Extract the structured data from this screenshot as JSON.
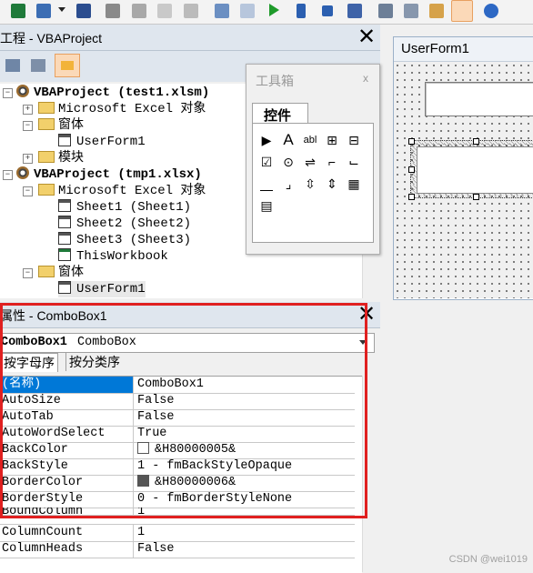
{
  "toolbar": {
    "icons": [
      "excel-icon",
      "insert-icon",
      "dropdown-arrow-icon",
      "save-icon",
      "cut-icon",
      "copy-icon",
      "paste-icon",
      "find-icon",
      "undo-icon",
      "redo-icon",
      "run-icon",
      "break-icon",
      "reset-icon",
      "design-mode-icon",
      "project-explorer-icon",
      "properties-icon",
      "object-browser-icon",
      "toolbox-icon",
      "help-icon"
    ]
  },
  "project_panel": {
    "title": "工程 - VBAProject",
    "tree": [
      {
        "label": "VBAProject (test1.xlsm)",
        "kind": "project"
      },
      {
        "label": "Microsoft Excel 对象",
        "kind": "folder"
      },
      {
        "label": "窗体",
        "kind": "folder"
      },
      {
        "label": "UserForm1",
        "kind": "form"
      },
      {
        "label": "模块",
        "kind": "folder"
      },
      {
        "label": "VBAProject (tmp1.xlsx)",
        "kind": "project"
      },
      {
        "label": "Microsoft Excel 对象",
        "kind": "folder"
      },
      {
        "label": "Sheet1 (Sheet1)",
        "kind": "sheet"
      },
      {
        "label": "Sheet2 (Sheet2)",
        "kind": "sheet"
      },
      {
        "label": "Sheet3 (Sheet3)",
        "kind": "sheet"
      },
      {
        "label": "ThisWorkbook",
        "kind": "workbook"
      },
      {
        "label": "窗体",
        "kind": "folder"
      },
      {
        "label": "UserForm1",
        "kind": "form"
      }
    ]
  },
  "toolbox": {
    "title": "工具箱",
    "close_label": "x",
    "tab_label": "控件",
    "tools": [
      "▶",
      "A",
      "abl",
      "⊞",
      "⊟",
      "☑",
      "⊙",
      "⇌",
      "⌐",
      "⌙",
      "⎽",
      "⌟",
      "⇳",
      "⇕",
      "▦",
      "▤"
    ]
  },
  "userform": {
    "title": "UserForm1"
  },
  "properties_panel": {
    "title": "属性 - ComboBox1",
    "object_name": "ComboBox1",
    "object_type": "ComboBox",
    "tabs": [
      "按字母序",
      "按分类序"
    ],
    "rows": [
      {
        "name": "(名称)",
        "value": "ComboBox1",
        "selected": true
      },
      {
        "name": "AutoSize",
        "value": "False"
      },
      {
        "name": "AutoTab",
        "value": "False"
      },
      {
        "name": "AutoWordSelect",
        "value": "True"
      },
      {
        "name": "BackColor",
        "value": "&H80000005&",
        "swatch": "#ffffff"
      },
      {
        "name": "BackStyle",
        "value": "1 - fmBackStyleOpaque"
      },
      {
        "name": "BorderColor",
        "value": "&H80000006&",
        "swatch": "#555555"
      },
      {
        "name": "BorderStyle",
        "value": "0 - fmBorderStyleNone"
      },
      {
        "name": "BoundColumn",
        "value": "1"
      },
      {
        "name": "ColumnCount",
        "value": "1"
      },
      {
        "name": "ColumnHeads",
        "value": "False"
      }
    ]
  },
  "colors": {
    "highlight": "#0078d7",
    "annotation_box": "#e02020"
  },
  "watermark": "CSDN @wei1019"
}
